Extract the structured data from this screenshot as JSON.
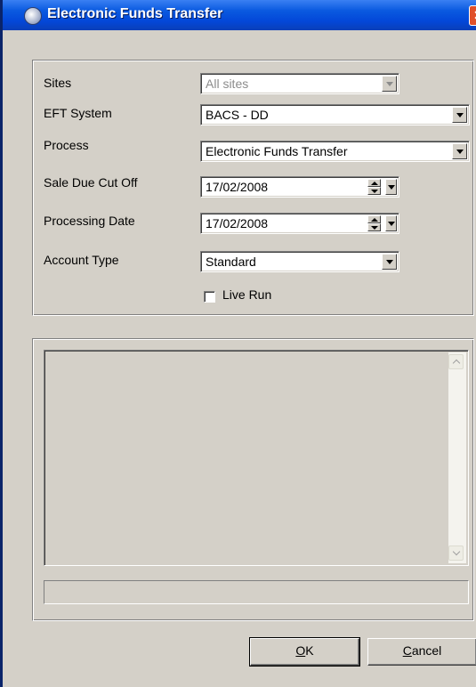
{
  "window": {
    "title": "Electronic Funds Transfer",
    "close_glyph": "✕",
    "app_icon": "app-icon",
    "title_color": "#0a5ae0"
  },
  "form": {
    "sites": {
      "label": "Sites",
      "value": "All sites",
      "enabled": false
    },
    "eft_system": {
      "label": "EFT System",
      "value": "BACS - DD"
    },
    "process": {
      "label": "Process",
      "value": "Electronic Funds Transfer"
    },
    "sale_due_cut_off": {
      "label": "Sale Due Cut Off",
      "value": "17/02/2008"
    },
    "processing_date": {
      "label": "Processing Date",
      "value": "17/02/2008"
    },
    "account_type": {
      "label": "Account Type",
      "value": "Standard"
    },
    "live_run": {
      "label": "Live Run",
      "checked": false
    }
  },
  "log": {
    "text": ""
  },
  "status": {
    "text": ""
  },
  "buttons": {
    "ok": {
      "accel": "O",
      "rest": "K"
    },
    "cancel": {
      "accel": "C",
      "rest": "ancel"
    }
  }
}
